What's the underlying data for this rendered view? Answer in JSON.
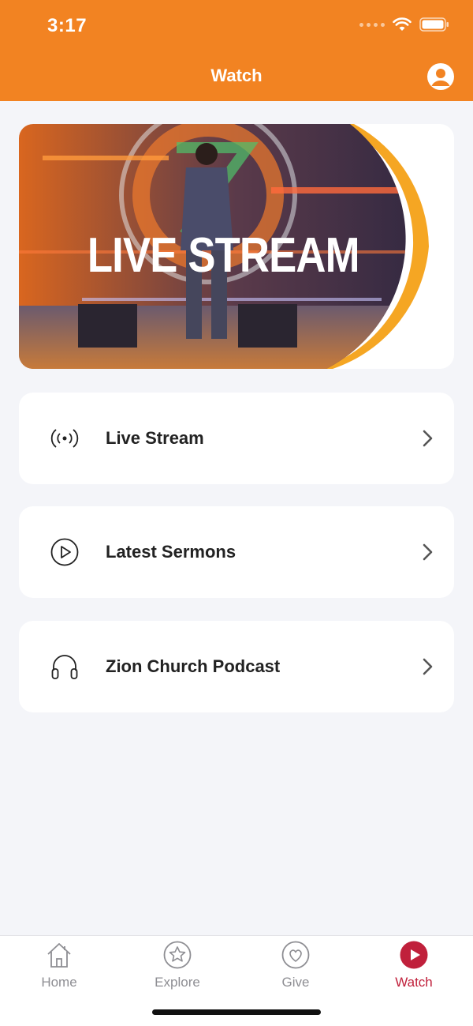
{
  "status": {
    "time": "3:17"
  },
  "header": {
    "title": "Watch"
  },
  "hero": {
    "text": "LIVE STREAM"
  },
  "menu": [
    {
      "label": "Live Stream",
      "icon": "broadcast-icon"
    },
    {
      "label": "Latest Sermons",
      "icon": "play-circle-icon"
    },
    {
      "label": "Zion Church Podcast",
      "icon": "headphones-icon"
    }
  ],
  "tabs": [
    {
      "label": "Home",
      "icon": "home-icon",
      "active": false
    },
    {
      "label": "Explore",
      "icon": "star-icon",
      "active": false
    },
    {
      "label": "Give",
      "icon": "heart-icon",
      "active": false
    },
    {
      "label": "Watch",
      "icon": "play-icon",
      "active": true
    }
  ],
  "colors": {
    "accent": "#f28322",
    "active_tab": "#c0203b",
    "inactive_tab": "#8e8e93",
    "background": "#f4f5f9"
  }
}
